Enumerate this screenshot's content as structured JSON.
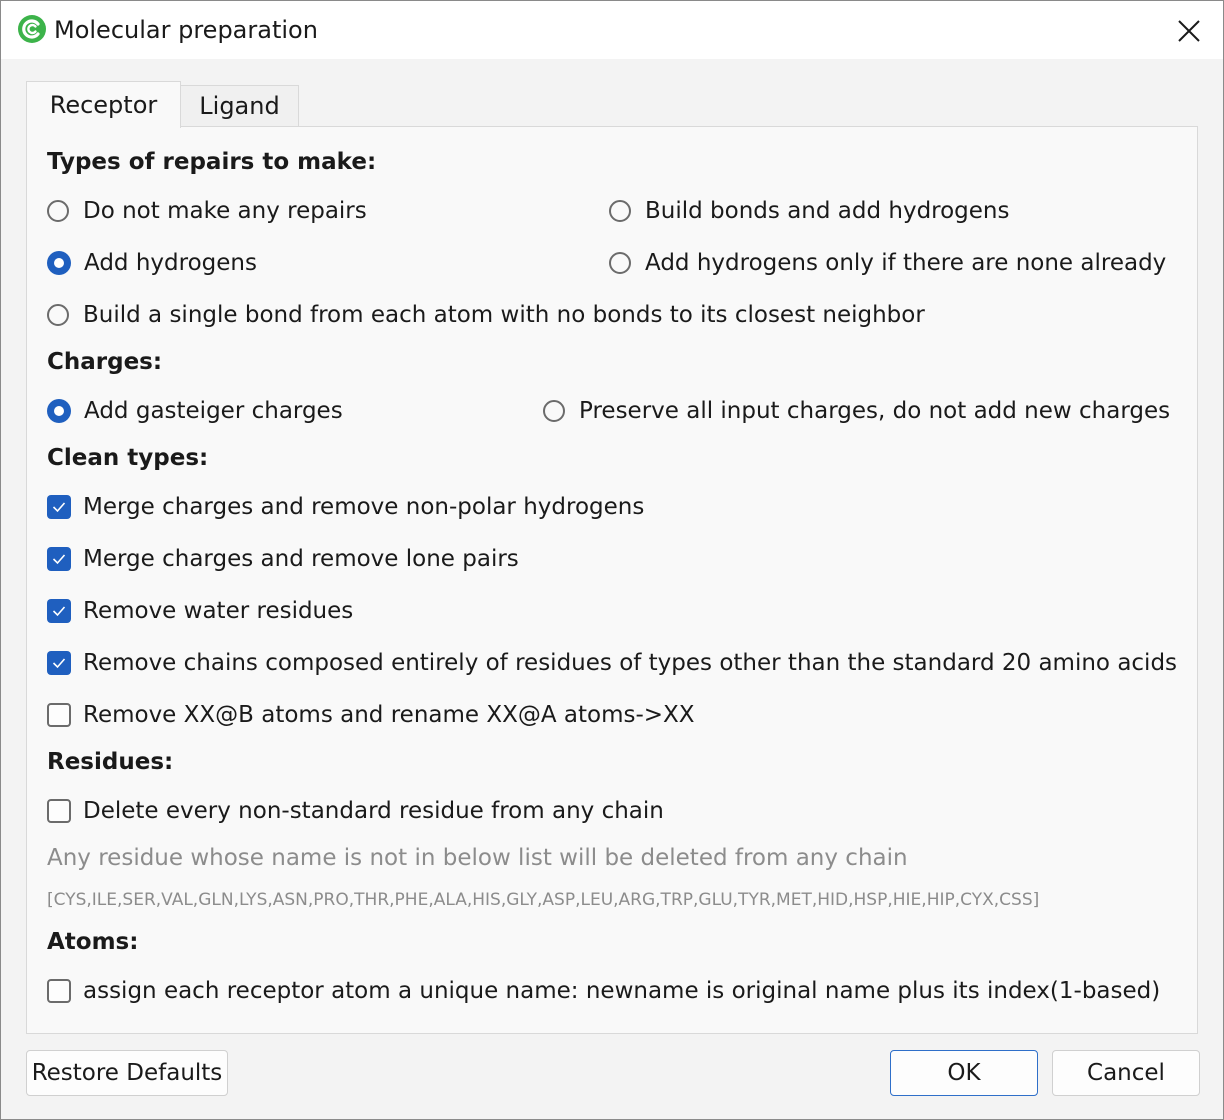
{
  "window": {
    "title": "Molecular preparation",
    "accent_color": "#1f5fbf",
    "icon": "app-logo-icon"
  },
  "tabs": [
    {
      "label": "Receptor",
      "active": true
    },
    {
      "label": "Ligand",
      "active": false
    }
  ],
  "repairs": {
    "heading": "Types of repairs to make:",
    "options": [
      {
        "label": "Do not make any repairs",
        "selected": false
      },
      {
        "label": "Build bonds and add hydrogens",
        "selected": false
      },
      {
        "label": "Add hydrogens",
        "selected": true
      },
      {
        "label": "Add hydrogens only if there are none already",
        "selected": false
      },
      {
        "label": "Build a single bond from each atom with no bonds to its closest neighbor",
        "selected": false
      }
    ]
  },
  "charges": {
    "heading": "Charges:",
    "options": [
      {
        "label": "Add gasteiger charges",
        "selected": true
      },
      {
        "label": "Preserve all input charges, do not add new charges",
        "selected": false
      }
    ]
  },
  "clean_types": {
    "heading": "Clean types:",
    "options": [
      {
        "label": "Merge charges and remove non-polar hydrogens",
        "checked": true
      },
      {
        "label": "Merge charges and remove lone pairs",
        "checked": true
      },
      {
        "label": "Remove water residues",
        "checked": true
      },
      {
        "label": "Remove chains composed entirely of residues of types other than the standard 20 amino acids",
        "checked": true
      },
      {
        "label": "Remove XX@B atoms and rename XX@A atoms->XX",
        "checked": false
      }
    ]
  },
  "residues": {
    "heading": "Residues:",
    "delete_option": {
      "label": "Delete every non-standard residue from any chain",
      "checked": false
    },
    "note": "Any residue whose name is not in below list will be deleted from any chain",
    "list": "[CYS,ILE,SER,VAL,GLN,LYS,ASN,PRO,THR,PHE,ALA,HIS,GLY,ASP,LEU,ARG,TRP,GLU,TYR,MET,HID,HSP,HIE,HIP,CYX,CSS]"
  },
  "atoms": {
    "heading": "Atoms:",
    "option": {
      "label": "assign each receptor atom a unique name: newname is original name plus its index(1-based)",
      "checked": false
    }
  },
  "footer": {
    "restore_label": "Restore Defaults",
    "ok_label": "OK",
    "cancel_label": "Cancel"
  }
}
